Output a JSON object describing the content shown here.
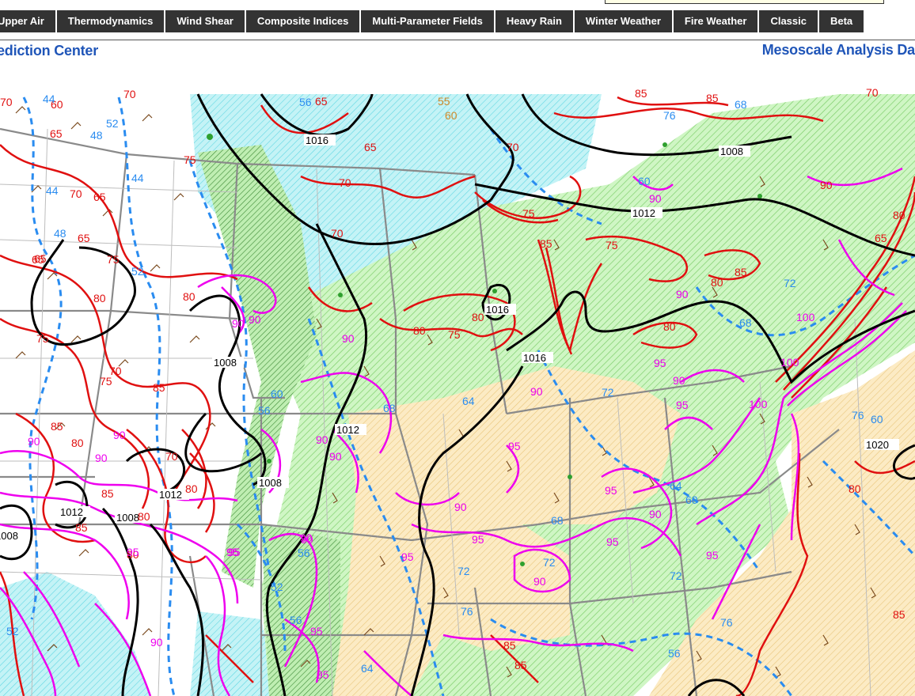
{
  "nav": {
    "items": [
      "Upper Air",
      "Thermodynamics",
      "Wind Shear",
      "Composite Indices",
      "Multi-Parameter Fields",
      "Heavy Rain",
      "Winter Weather",
      "Fire Weather",
      "Classic",
      "Beta"
    ]
  },
  "header": {
    "left_brand": "ediction Center",
    "right_title": "Mesoscale Analysis Da"
  },
  "colors": {
    "nav_bg": "#333333",
    "brand_blue": "#1f55b8",
    "isobar": "#000000",
    "temp_red": "#e01010",
    "temp_magenta": "#ee00ee",
    "dew_blue": "#2a8cf0",
    "fill_green": "#bff5b0",
    "fill_tan": "#fbe6b8",
    "fill_cyan": "#b6f0f4"
  },
  "map": {
    "isobar_labels": [
      "1016",
      "1008",
      "1012",
      "1016",
      "1016",
      "1008",
      "1012",
      "1008",
      "1012",
      "1008",
      "1012",
      "1008",
      "1020"
    ],
    "red_labels": [
      "70",
      "60",
      "70",
      "65",
      "75",
      "70",
      "65",
      "65",
      "65",
      "70",
      "65",
      "70",
      "65",
      "70",
      "85",
      "80",
      "75",
      "80",
      "80",
      "75",
      "70",
      "70",
      "85",
      "80",
      "85",
      "75",
      "65",
      "75",
      "80",
      "85",
      "85",
      "80",
      "75",
      "80",
      "75",
      "80",
      "85",
      "80",
      "85",
      "85",
      "65",
      "80",
      "85",
      "70",
      "80",
      "85",
      "85",
      "90",
      "80"
    ],
    "magenta_labels": [
      "90",
      "90",
      "90",
      "90",
      "90",
      "90",
      "90",
      "95",
      "95",
      "95",
      "90",
      "95",
      "90",
      "95",
      "90",
      "95",
      "90",
      "95",
      "95",
      "90",
      "95",
      "100",
      "100",
      "100",
      "90",
      "95",
      "90",
      "95",
      "90",
      "90",
      "95",
      "90",
      "95",
      "90"
    ],
    "blue_labels": [
      "44",
      "48",
      "52",
      "56",
      "44",
      "44",
      "48",
      "52",
      "56",
      "60",
      "64",
      "68",
      "72",
      "76",
      "72",
      "68",
      "64",
      "60",
      "56",
      "52",
      "68",
      "72",
      "76",
      "56",
      "60",
      "72",
      "76",
      "68",
      "76",
      "72",
      "64",
      "60",
      "56",
      "52"
    ],
    "orange_labels": [
      "55",
      "60"
    ]
  }
}
